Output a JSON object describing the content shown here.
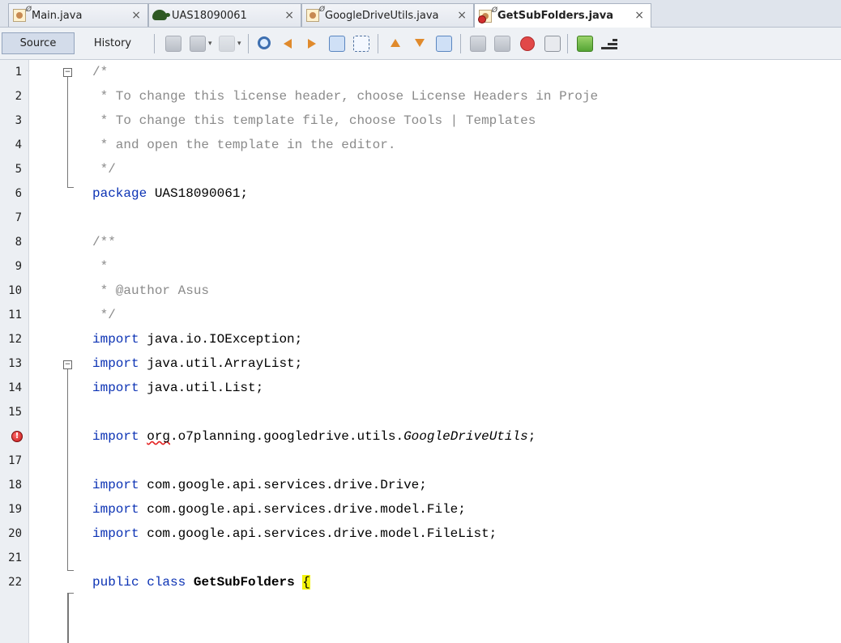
{
  "tabs": [
    {
      "label": "Main.java",
      "icon": "java-file-icon",
      "badge": "Ø",
      "active": false
    },
    {
      "label": "UAS18090061",
      "icon": "turtle-project-icon",
      "badge": "",
      "active": false
    },
    {
      "label": "GoogleDriveUtils.java",
      "icon": "java-file-icon",
      "badge": "Ø",
      "active": false
    },
    {
      "label": "GetSubFolders.java",
      "icon": "java-file-error-icon",
      "badge": "Ø",
      "active": true
    }
  ],
  "close_glyph": "×",
  "toolbar": {
    "source_label": "Source",
    "history_label": "History",
    "dropdown_glyph": "▾"
  },
  "editor": {
    "lines": [
      {
        "num": "1",
        "segments": [
          {
            "t": "/*",
            "c": "cmt"
          }
        ]
      },
      {
        "num": "2",
        "segments": [
          {
            "t": " * To change this license header, choose License Headers in Proje",
            "c": "cmt"
          }
        ]
      },
      {
        "num": "3",
        "segments": [
          {
            "t": " * To change this template file, choose Tools | Templates",
            "c": "cmt"
          }
        ]
      },
      {
        "num": "4",
        "segments": [
          {
            "t": " * and open the template in the editor.",
            "c": "cmt"
          }
        ]
      },
      {
        "num": "5",
        "segments": [
          {
            "t": " */",
            "c": "cmt"
          }
        ]
      },
      {
        "num": "6",
        "segments": [
          {
            "t": "package",
            "c": "kw"
          },
          {
            "t": " UAS18090061;",
            "c": ""
          }
        ]
      },
      {
        "num": "7",
        "segments": []
      },
      {
        "num": "8",
        "segments": [
          {
            "t": "/**",
            "c": "cmt"
          }
        ]
      },
      {
        "num": "9",
        "segments": [
          {
            "t": " *",
            "c": "cmt"
          }
        ]
      },
      {
        "num": "10",
        "segments": [
          {
            "t": " * @author Asus",
            "c": "cmt"
          }
        ]
      },
      {
        "num": "11",
        "segments": [
          {
            "t": " */",
            "c": "cmt"
          }
        ]
      },
      {
        "num": "12",
        "segments": [
          {
            "t": "import",
            "c": "kw"
          },
          {
            "t": " java.io.IOException;",
            "c": ""
          }
        ]
      },
      {
        "num": "13",
        "segments": [
          {
            "t": "import",
            "c": "kw"
          },
          {
            "t": " java.util.ArrayList;",
            "c": ""
          }
        ]
      },
      {
        "num": "14",
        "segments": [
          {
            "t": "import",
            "c": "kw"
          },
          {
            "t": " java.util.List;",
            "c": ""
          }
        ]
      },
      {
        "num": "15",
        "segments": []
      },
      {
        "num": "",
        "error": true,
        "segments": [
          {
            "t": "import",
            "c": "kw"
          },
          {
            "t": " ",
            "c": ""
          },
          {
            "t": "org",
            "c": "err-underline"
          },
          {
            "t": ".o7planning.googledrive.utils.",
            "c": ""
          },
          {
            "t": "GoogleDriveUtils",
            "c": "ital"
          },
          {
            "t": ";",
            "c": ""
          }
        ]
      },
      {
        "num": "17",
        "segments": []
      },
      {
        "num": "18",
        "segments": [
          {
            "t": "import",
            "c": "kw"
          },
          {
            "t": " com.google.api.services.drive.Drive;",
            "c": ""
          }
        ]
      },
      {
        "num": "19",
        "segments": [
          {
            "t": "import",
            "c": "kw"
          },
          {
            "t": " com.google.api.services.drive.model.File;",
            "c": ""
          }
        ]
      },
      {
        "num": "20",
        "segments": [
          {
            "t": "import",
            "c": "kw"
          },
          {
            "t": " com.google.api.services.drive.model.FileList;",
            "c": ""
          }
        ]
      },
      {
        "num": "21",
        "segments": []
      },
      {
        "num": "22",
        "segments": [
          {
            "t": "public",
            "c": "kw"
          },
          {
            "t": " ",
            "c": ""
          },
          {
            "t": "class",
            "c": "kw"
          },
          {
            "t": " ",
            "c": ""
          },
          {
            "t": "GetSubFolders",
            "c": "cls"
          },
          {
            "t": " ",
            "c": ""
          },
          {
            "t": "{",
            "c": "brace-hl"
          }
        ]
      }
    ],
    "colors": {
      "keyword": "#0b32b4",
      "comment": "#8a8a8a",
      "error": "#e32020",
      "highlight": "#f4f40a"
    }
  }
}
